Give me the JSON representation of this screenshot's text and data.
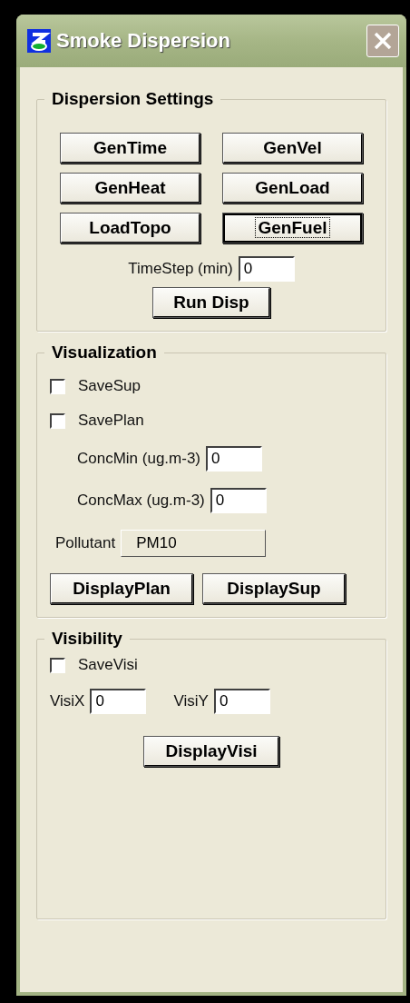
{
  "window": {
    "title": "Smoke Dispersion"
  },
  "dispersion_settings": {
    "title": "Dispersion Settings",
    "buttons": [
      {
        "label": "GenTime",
        "focused": false
      },
      {
        "label": "GenVel",
        "focused": false
      },
      {
        "label": "GenHeat",
        "focused": false
      },
      {
        "label": "GenLoad",
        "focused": false
      },
      {
        "label": "LoadTopo",
        "focused": false
      },
      {
        "label": "GenFuel",
        "focused": true
      }
    ],
    "timestep": {
      "label": "TimeStep (min)",
      "value": "0"
    },
    "run_button": "Run Disp"
  },
  "visualization": {
    "title": "Visualization",
    "checkboxes": [
      {
        "label": "SaveSup",
        "checked": false
      },
      {
        "label": "SavePlan",
        "checked": false
      }
    ],
    "fields": [
      {
        "label": "ConcMin (ug.m-3)",
        "value": "0"
      },
      {
        "label": "ConcMax (ug.m-3)",
        "value": "0"
      }
    ],
    "pollutant": {
      "label": "Pollutant",
      "value": "PM10"
    },
    "buttons": [
      "DisplayPlan",
      "DisplaySup"
    ]
  },
  "visibility": {
    "title": "Visibility",
    "checkbox": {
      "label": "SaveVisi",
      "checked": false
    },
    "fields": [
      {
        "label": "VisiX",
        "value": "0"
      },
      {
        "label": "VisiY",
        "value": "0"
      }
    ],
    "button": "DisplayVisi"
  }
}
